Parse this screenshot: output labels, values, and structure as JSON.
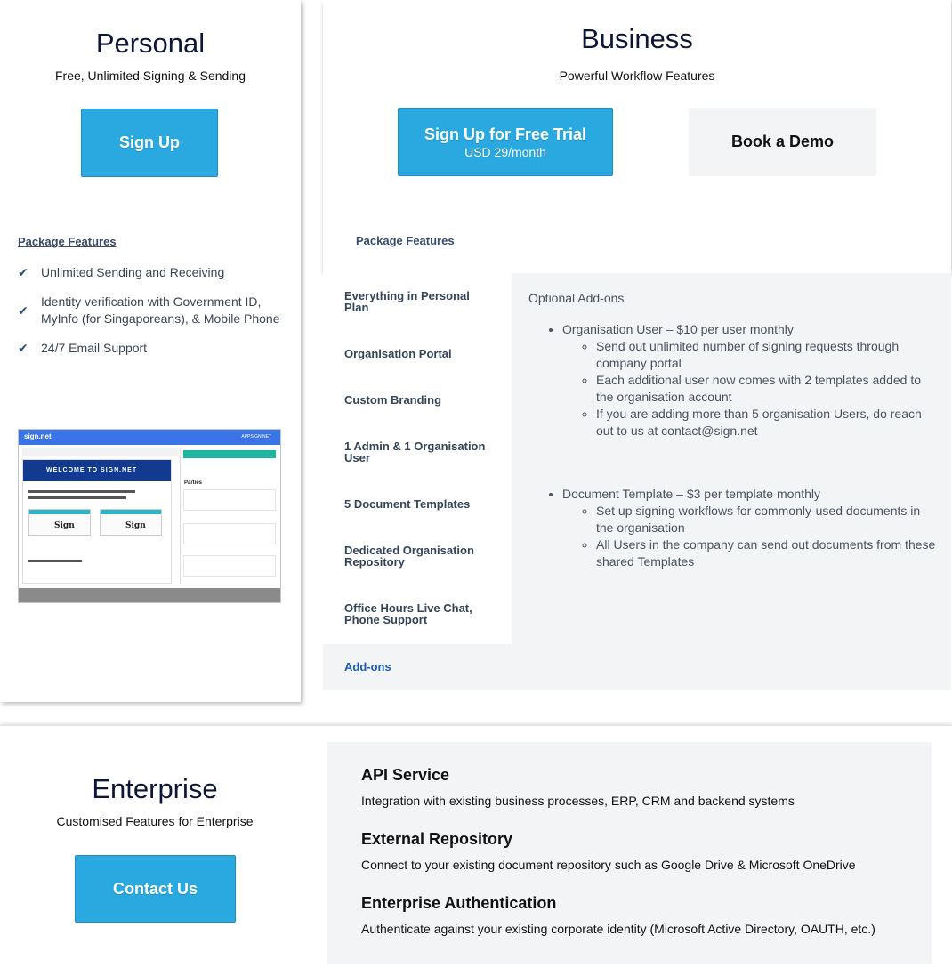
{
  "personal": {
    "title": "Personal",
    "subtitle": "Free, Unlimited Signing & Sending",
    "button_label": "Sign Up",
    "package_link": "Package Features",
    "features": [
      "Unlimited Sending and Receiving",
      "Identity verification with Government ID, MyInfo (for Singaporeans), & Mobile Phone",
      "24/7 Email Support"
    ],
    "preview": {
      "logo": "sign.net",
      "header_right": "APPSIGN.NET",
      "welcome": "WELCOME TO SIGN.NET",
      "signature_word": "Sign",
      "parties_label": "Parties"
    }
  },
  "business": {
    "title": "Business",
    "subtitle": "Powerful Workflow Features",
    "trial_button": {
      "label": "Sign Up for Free Trial",
      "price": "USD 29/month"
    },
    "demo_button": "Book a Demo",
    "package_link": "Package Features",
    "sidebar": [
      "Everything in Personal Plan",
      "Organisation Portal",
      "Custom Branding",
      "1 Admin & 1 Organisation User",
      "5 Document Templates",
      "Dedicated Organisation Repository",
      "Office Hours Live Chat, Phone Support"
    ],
    "active_tab": "Add-ons",
    "addons": {
      "heading": "Optional Add-ons",
      "items": [
        {
          "label": "Organisation User – $10 per user monthly",
          "subitems": [
            "Send out unlimited number of signing requests through company portal",
            "Each additional user now comes with 2 templates added to the organisation account",
            "If you are adding more than 5 organisation Users, do reach out to us at contact@sign.net"
          ]
        },
        {
          "label": "Document Template – $3 per template monthly",
          "subitems": [
            "Set up signing workflows for commonly-used documents in the organisation",
            "All Users in the company can send out documents from these shared Templates"
          ]
        }
      ]
    }
  },
  "enterprise": {
    "title": "Enterprise",
    "subtitle": "Customised Features for Enterprise",
    "button_label": "Contact Us",
    "features": [
      {
        "title": "API Service",
        "desc": "Integration with existing business processes, ERP, CRM and backend systems"
      },
      {
        "title": "External Repository",
        "desc": "Connect to your existing document repository such as Google Drive & Microsoft OneDrive"
      },
      {
        "title": "Enterprise Authentication",
        "desc": "Authenticate against your existing corporate identity (Microsoft Active Directory, OAUTH, etc.)"
      }
    ]
  },
  "colors": {
    "accent_blue": "#29a9e0",
    "panel_grey": "#f3f4f6",
    "title_navy": "#0e1637"
  },
  "icons": {
    "feature_bullet": "check-icon"
  }
}
